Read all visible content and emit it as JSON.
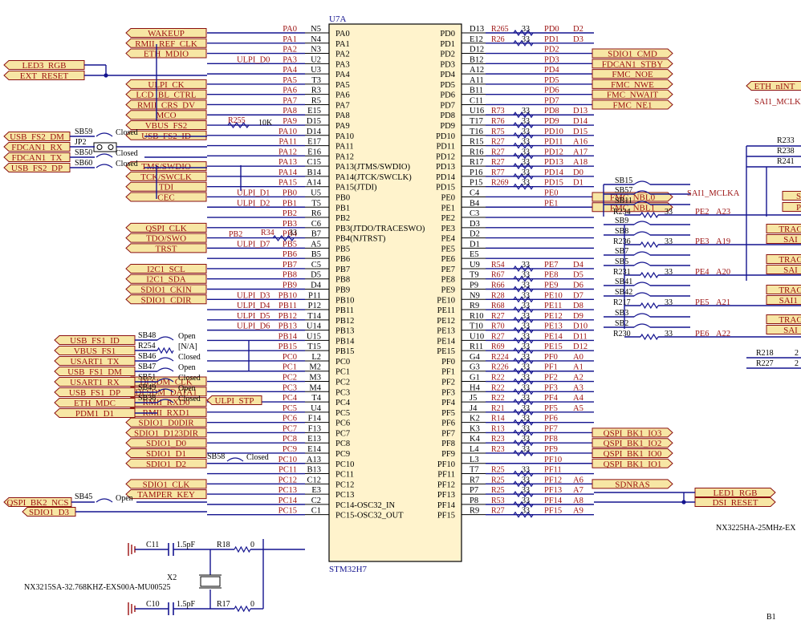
{
  "colors": {
    "wire": "#14148f",
    "label_red": "#9b1010",
    "port_fill": "#f7e6a4",
    "port_stroke": "#8a1010",
    "chip_fill": "#fff3cc",
    "black": "#000000"
  },
  "chip": {
    "designator": "U7A",
    "part": "STM32H7",
    "left_pins": [
      {
        "num": "N5",
        "name": "PA0"
      },
      {
        "num": "N4",
        "name": "PA1"
      },
      {
        "num": "N3",
        "name": "PA2"
      },
      {
        "num": "U2",
        "name": "PA3"
      },
      {
        "num": "U3",
        "name": "PA4"
      },
      {
        "num": "T3",
        "name": "PA5"
      },
      {
        "num": "R3",
        "name": "PA6"
      },
      {
        "num": "R5",
        "name": "PA7"
      },
      {
        "num": "E15",
        "name": "PA8"
      },
      {
        "num": "D15",
        "name": "PA9"
      },
      {
        "num": "D14",
        "name": "PA10"
      },
      {
        "num": "E17",
        "name": "PA11"
      },
      {
        "num": "E16",
        "name": "PA12"
      },
      {
        "num": "C15",
        "name": "PA13(JTMS/SWDIO)"
      },
      {
        "num": "B14",
        "name": "PA14(JTCK/SWCLK)"
      },
      {
        "num": "A14",
        "name": "PA15(JTDI)"
      },
      {
        "num": "U5",
        "name": "PB0"
      },
      {
        "num": "T5",
        "name": "PB1"
      },
      {
        "num": "R6",
        "name": "PB2"
      },
      {
        "num": "C6",
        "name": "PB3(JTDO/TRACESWO)"
      },
      {
        "num": "B7",
        "name": "PB4(NJTRST)"
      },
      {
        "num": "A5",
        "name": "PB5"
      },
      {
        "num": "B5",
        "name": "PB6"
      },
      {
        "num": "C5",
        "name": "PB7"
      },
      {
        "num": "D5",
        "name": "PB8"
      },
      {
        "num": "D4",
        "name": "PB9"
      },
      {
        "num": "P11",
        "name": "PB10"
      },
      {
        "num": "P12",
        "name": "PB11"
      },
      {
        "num": "T14",
        "name": "PB12"
      },
      {
        "num": "U14",
        "name": "PB13"
      },
      {
        "num": "U15",
        "name": "PB14"
      },
      {
        "num": "T15",
        "name": "PB15"
      },
      {
        "num": "L2",
        "name": "PC0"
      },
      {
        "num": "M2",
        "name": "PC1"
      },
      {
        "num": "M3",
        "name": "PC2"
      },
      {
        "num": "M4",
        "name": "PC3"
      },
      {
        "num": "T4",
        "name": "PC4"
      },
      {
        "num": "U4",
        "name": "PC5"
      },
      {
        "num": "F14",
        "name": "PC6"
      },
      {
        "num": "F13",
        "name": "PC7"
      },
      {
        "num": "E13",
        "name": "PC8"
      },
      {
        "num": "E14",
        "name": "PC9"
      },
      {
        "num": "A13",
        "name": "PC10"
      },
      {
        "num": "B13",
        "name": "PC11"
      },
      {
        "num": "C12",
        "name": "PC12"
      },
      {
        "num": "E3",
        "name": "PC13"
      },
      {
        "num": "C2",
        "name": "PC14-OSC32_IN"
      },
      {
        "num": "C1",
        "name": "PC15-OSC32_OUT"
      }
    ],
    "right_pins": [
      {
        "num": "D13",
        "name": "PD0"
      },
      {
        "num": "E12",
        "name": "PD1"
      },
      {
        "num": "D12",
        "name": "PD2"
      },
      {
        "num": "B12",
        "name": "PD3"
      },
      {
        "num": "A12",
        "name": "PD4"
      },
      {
        "num": "A11",
        "name": "PD5"
      },
      {
        "num": "B11",
        "name": "PD6"
      },
      {
        "num": "C11",
        "name": "PD7"
      },
      {
        "num": "U16",
        "name": "PD8"
      },
      {
        "num": "T17",
        "name": "PD9"
      },
      {
        "num": "T16",
        "name": "PD10"
      },
      {
        "num": "R15",
        "name": "PD11"
      },
      {
        "num": "R16",
        "name": "PD12"
      },
      {
        "num": "R17",
        "name": "PD13"
      },
      {
        "num": "P16",
        "name": "PD14"
      },
      {
        "num": "P15",
        "name": "PD15"
      },
      {
        "num": "C4",
        "name": "PE0"
      },
      {
        "num": "B4",
        "name": "PE1"
      },
      {
        "num": "C3",
        "name": "PE2"
      },
      {
        "num": "D3",
        "name": "PE3"
      },
      {
        "num": "D2",
        "name": "PE4"
      },
      {
        "num": "D1",
        "name": "PE5"
      },
      {
        "num": "E5",
        "name": "PE6"
      },
      {
        "num": "U9",
        "name": "PE7"
      },
      {
        "num": "T9",
        "name": "PE8"
      },
      {
        "num": "P9",
        "name": "PE9"
      },
      {
        "num": "N9",
        "name": "PE10"
      },
      {
        "num": "R9",
        "name": "PE11"
      },
      {
        "num": "R10",
        "name": "PE12"
      },
      {
        "num": "T10",
        "name": "PE13"
      },
      {
        "num": "U10",
        "name": "PE14"
      },
      {
        "num": "R11",
        "name": "PE15"
      },
      {
        "num": "G4",
        "name": "PF0"
      },
      {
        "num": "G3",
        "name": "PF1"
      },
      {
        "num": "G1",
        "name": "PF2"
      },
      {
        "num": "H4",
        "name": "PF3"
      },
      {
        "num": "J5",
        "name": "PF4"
      },
      {
        "num": "J4",
        "name": "PF5"
      },
      {
        "num": "K2",
        "name": "PF6"
      },
      {
        "num": "K3",
        "name": "PF7"
      },
      {
        "num": "K4",
        "name": "PF8"
      },
      {
        "num": "L4",
        "name": "PF9"
      },
      {
        "num": "L3",
        "name": "PF10"
      },
      {
        "num": "T7",
        "name": "PF11"
      },
      {
        "num": "R7",
        "name": "PF12"
      },
      {
        "num": "P7",
        "name": "PF13"
      },
      {
        "num": "P8",
        "name": "PF14"
      },
      {
        "num": "R9",
        "name": "PF15"
      }
    ]
  },
  "left_net_labels": [
    "",
    "",
    "",
    "ULPI_D0",
    "",
    "",
    "",
    "",
    "",
    "",
    "",
    "",
    "",
    "",
    "",
    "",
    "ULPI_D1",
    "ULPI_D2",
    "",
    "",
    "",
    "ULPI_D7",
    "",
    "",
    "",
    "",
    "ULPI_D3",
    "ULPI_D4",
    "ULPI_D5",
    "ULPI_D6",
    "",
    "",
    "",
    "",
    "",
    "",
    "",
    "",
    "",
    "",
    "",
    "",
    "",
    "",
    "",
    "",
    "",
    ""
  ],
  "right_nets": [
    {
      "res": "R265",
      "val": "33",
      "net": "PD0",
      "sig": "D2"
    },
    {
      "res": "R26",
      "val": "33",
      "net": "PD1",
      "sig": "D3"
    },
    {
      "res": "",
      "val": "",
      "net": "PD2",
      "sig": ""
    },
    {
      "res": "",
      "val": "",
      "net": "PD3",
      "sig": ""
    },
    {
      "res": "",
      "val": "",
      "net": "PD4",
      "sig": ""
    },
    {
      "res": "",
      "val": "",
      "net": "PD5",
      "sig": ""
    },
    {
      "res": "",
      "val": "",
      "net": "PD6",
      "sig": ""
    },
    {
      "res": "",
      "val": "",
      "net": "PD7",
      "sig": ""
    },
    {
      "res": "R73",
      "val": "33",
      "net": "PD8",
      "sig": "D13"
    },
    {
      "res": "R76",
      "val": "33",
      "net": "PD9",
      "sig": "D14"
    },
    {
      "res": "R75",
      "val": "33",
      "net": "PD10",
      "sig": "D15"
    },
    {
      "res": "R27",
      "val": "33",
      "net": "PD11",
      "sig": "A16"
    },
    {
      "res": "R27",
      "val": "33",
      "net": "PD12",
      "sig": "A17"
    },
    {
      "res": "R27",
      "val": "33",
      "net": "PD13",
      "sig": "A18"
    },
    {
      "res": "R77",
      "val": "33",
      "net": "PD14",
      "sig": "D0"
    },
    {
      "res": "R269",
      "val": "33",
      "net": "PD15",
      "sig": "D1"
    },
    {
      "res": "",
      "val": "",
      "net": "PE0",
      "sig": ""
    },
    {
      "res": "",
      "val": "",
      "net": "PE1",
      "sig": ""
    },
    {
      "res": "",
      "val": "",
      "net": "",
      "sig": ""
    },
    {
      "res": "",
      "val": "",
      "net": "",
      "sig": ""
    },
    {
      "res": "",
      "val": "",
      "net": "",
      "sig": ""
    },
    {
      "res": "",
      "val": "",
      "net": "",
      "sig": ""
    },
    {
      "res": "",
      "val": "",
      "net": "",
      "sig": ""
    },
    {
      "res": "R54",
      "val": "33",
      "net": "PE7",
      "sig": "D4"
    },
    {
      "res": "R67",
      "val": "33",
      "net": "PE8",
      "sig": "D5"
    },
    {
      "res": "R66",
      "val": "33",
      "net": "PE9",
      "sig": "D6"
    },
    {
      "res": "R28",
      "val": "33",
      "net": "PE10",
      "sig": "D7"
    },
    {
      "res": "R68",
      "val": "33",
      "net": "PE11",
      "sig": "D8"
    },
    {
      "res": "R27",
      "val": "33",
      "net": "PE12",
      "sig": "D9"
    },
    {
      "res": "R70",
      "val": "33",
      "net": "PE13",
      "sig": "D10"
    },
    {
      "res": "R27",
      "val": "33",
      "net": "PE14",
      "sig": "D11"
    },
    {
      "res": "R69",
      "val": "33",
      "net": "PE15",
      "sig": "D12"
    },
    {
      "res": "R224",
      "val": "33",
      "net": "PF0",
      "sig": "A0"
    },
    {
      "res": "R226",
      "val": "33",
      "net": "PF1",
      "sig": "A1"
    },
    {
      "res": "R22",
      "val": "33",
      "net": "PF2",
      "sig": "A2"
    },
    {
      "res": "R22",
      "val": "33",
      "net": "PF3",
      "sig": "A3"
    },
    {
      "res": "R22",
      "val": "33",
      "net": "PF4",
      "sig": "A4"
    },
    {
      "res": "R21",
      "val": "33",
      "net": "PF5",
      "sig": "A5"
    },
    {
      "res": "R14",
      "val": "33",
      "net": "PF6",
      "sig": ""
    },
    {
      "res": "R13",
      "val": "33",
      "net": "PF7",
      "sig": ""
    },
    {
      "res": "R23",
      "val": "33",
      "net": "PF8",
      "sig": ""
    },
    {
      "res": "R23",
      "val": "33",
      "net": "PF9",
      "sig": ""
    },
    {
      "res": "",
      "val": "",
      "net": "PF10",
      "sig": ""
    },
    {
      "res": "R25",
      "val": "33",
      "net": "PF11",
      "sig": ""
    },
    {
      "res": "R25",
      "val": "33",
      "net": "PF12",
      "sig": "A6"
    },
    {
      "res": "R25",
      "val": "33",
      "net": "PF13",
      "sig": "A7"
    },
    {
      "res": "R53",
      "val": "33",
      "net": "PF14",
      "sig": "A8"
    },
    {
      "res": "R27",
      "val": "33",
      "net": "PF15",
      "sig": "A9"
    }
  ],
  "left_ports": [
    {
      "label": "WAKEUP",
      "row": 0
    },
    {
      "label": "RMII_REF_CLK",
      "row": 1
    },
    {
      "label": "ETH_MDIO",
      "row": 2
    },
    {
      "label": "ULPI_CK",
      "row": 5
    },
    {
      "label": "LCD_BL_CTRL",
      "row": 6
    },
    {
      "label": "RMII_CRS_DV",
      "row": 7
    },
    {
      "label": "MCO",
      "row": 8
    },
    {
      "label": "VBUS_FS2",
      "row": 9
    },
    {
      "label": "USB_FS2_ID",
      "row": 10
    },
    {
      "label": "TMS/SWDIO",
      "row": 13
    },
    {
      "label": "TCK/SWCLK",
      "row": 14
    },
    {
      "label": "TDI",
      "row": 15
    },
    {
      "label": "CEC",
      "row": 16
    },
    {
      "label": "QSPI_CLK",
      "row": 19
    },
    {
      "label": "TDO/SWO",
      "row": 20
    },
    {
      "label": "TRST",
      "row": 21
    },
    {
      "label": "I2C1_SCL",
      "row": 23
    },
    {
      "label": "I2C1_SDA",
      "row": 24
    },
    {
      "label": "SDIO1_CKIN",
      "row": 25
    },
    {
      "label": "SDIO1_CDIR",
      "row": 26
    },
    {
      "label": "DFSDM_CLK",
      "row": 34
    },
    {
      "label": "DFSDM_DATA1",
      "row": 35
    },
    {
      "label": "RMII_RXD0",
      "row": 36
    },
    {
      "label": "RMII_RXD1",
      "row": 37
    },
    {
      "label": "SDIO1_D0DIR",
      "row": 38
    },
    {
      "label": "SDIO1_D123DIR",
      "row": 39
    },
    {
      "label": "SDIO1_D0",
      "row": 40
    },
    {
      "label": "SDIO1_D1",
      "row": 41
    },
    {
      "label": "SDIO1_D2",
      "row": 42
    },
    {
      "label": "SDIO1_CLK",
      "row": 44
    },
    {
      "label": "TAMPER_KEY",
      "row": 45
    }
  ],
  "far_left": {
    "led3_rgb": "LED3_RGB",
    "ext_reset": "EXT_RESET",
    "usb_fs2_dm": "USB_FS2_DM",
    "fdcan1_rx": "FDCAN1_RX",
    "fdcan1_tx": "FDCAN1_TX",
    "usb_fs2_dp": "USB_FS2_DP",
    "jp2": "JP2",
    "sb59": "SB59",
    "sb50": "SB50",
    "sb60": "SB60",
    "closed": "Closed",
    "open": "Open",
    "usb_fs1_id": "USB_FS1_ID",
    "vbus_fs1": "VBUS_FS1",
    "usart1_tx": "USART1_TX",
    "usb_fs1_dm": "USB_FS1_DM",
    "usart1_rx": "USART1_RX",
    "usb_fs1_dp": "USB_FS1_DP",
    "eth_mdc": "ETH_MDC",
    "pdm1_d1": "PDM1_D1",
    "sb48": "SB48",
    "r254": "R254",
    "na": "[N/A]",
    "sb46": "SB46",
    "sb47": "SB47",
    "sb51": "SB51",
    "sb49": "SB49",
    "sb38": "SB38",
    "ulpi_stp": "ULPI_STP",
    "sb58": "SB58",
    "qspi_bk2_ncs": "QSPI_BK2_NCS",
    "sdio1_d3": "SDIO1_D3",
    "sb45": "SB45",
    "r255": "R255",
    "r255_val": "10K",
    "r34": "R34",
    "r34_val": "33",
    "pb2": "PB2",
    "c11": "C11",
    "c11_val": "1.5pF",
    "r18": "R18",
    "r18_val": "0",
    "c10": "C10",
    "c10_val": "1.5pF",
    "r17": "R17",
    "r17_val": "0",
    "x2": "X2",
    "x2_part": "NX3215SA-32.768KHZ-EXS00A-MU00525"
  },
  "right_ports": [
    {
      "label": "SDIO1_CMD",
      "row": 2
    },
    {
      "label": "FDCAN1_STBY",
      "row": 3
    },
    {
      "label": "FMC_NOE",
      "row": 4
    },
    {
      "label": "FMC_NWE",
      "row": 5
    },
    {
      "label": "FMC_NWAIT",
      "row": 6
    },
    {
      "label": "FMC_NE1",
      "row": 7
    },
    {
      "label": "FMC_NBL0",
      "row": 16
    },
    {
      "label": "FMC_NBL1",
      "row": 17
    },
    {
      "label": "QSPI_BK1_IO3",
      "row": 39
    },
    {
      "label": "QSPI_BK1_IO2",
      "row": 40
    },
    {
      "label": "QSPI_BK1_IO0",
      "row": 41
    },
    {
      "label": "QSPI_BK1_IO1",
      "row": 42
    },
    {
      "label": "SDNRAS",
      "row": 44
    }
  ],
  "far_right": {
    "eth_nint": "ETH_nINT",
    "sai1_mclk": "SAI1_MCLK",
    "r233": "R233",
    "r238": "R238",
    "r241": "R241",
    "sb15": "SB15",
    "sb57": "SB57",
    "sb11": "SB11",
    "r234": "R234",
    "sai1_mclka": "SAI1_MCLKA",
    "pe2": "PE2",
    "a23": "A23",
    "sb9": "SB9",
    "sb8": "SB8",
    "r236": "R236",
    "pe3": "PE3",
    "a19": "A19",
    "sb7": "SB7",
    "sb5": "SB5",
    "r231": "R231",
    "pe4": "PE4",
    "a20": "A20",
    "sb41": "SB41",
    "sb42": "SB42",
    "r217": "R217",
    "pe5": "PE5",
    "a21": "A21",
    "sb3": "SB3",
    "sb2": "SB2",
    "r230": "R230",
    "pe6": "PE6",
    "a22": "A22",
    "r218": "R218",
    "r227": "R227",
    "v33": "33",
    "two": "2",
    "led1_rgb": "LED1_RGB",
    "dsi_reset": "DSI_RESET",
    "osc": "NX3225HA-25MHz-EX",
    "b1": "B1",
    "trac": "TRAC",
    "sai": "SAI",
    "s": "S",
    "p": "P",
    "sai1_trunc": "SAI1_"
  }
}
